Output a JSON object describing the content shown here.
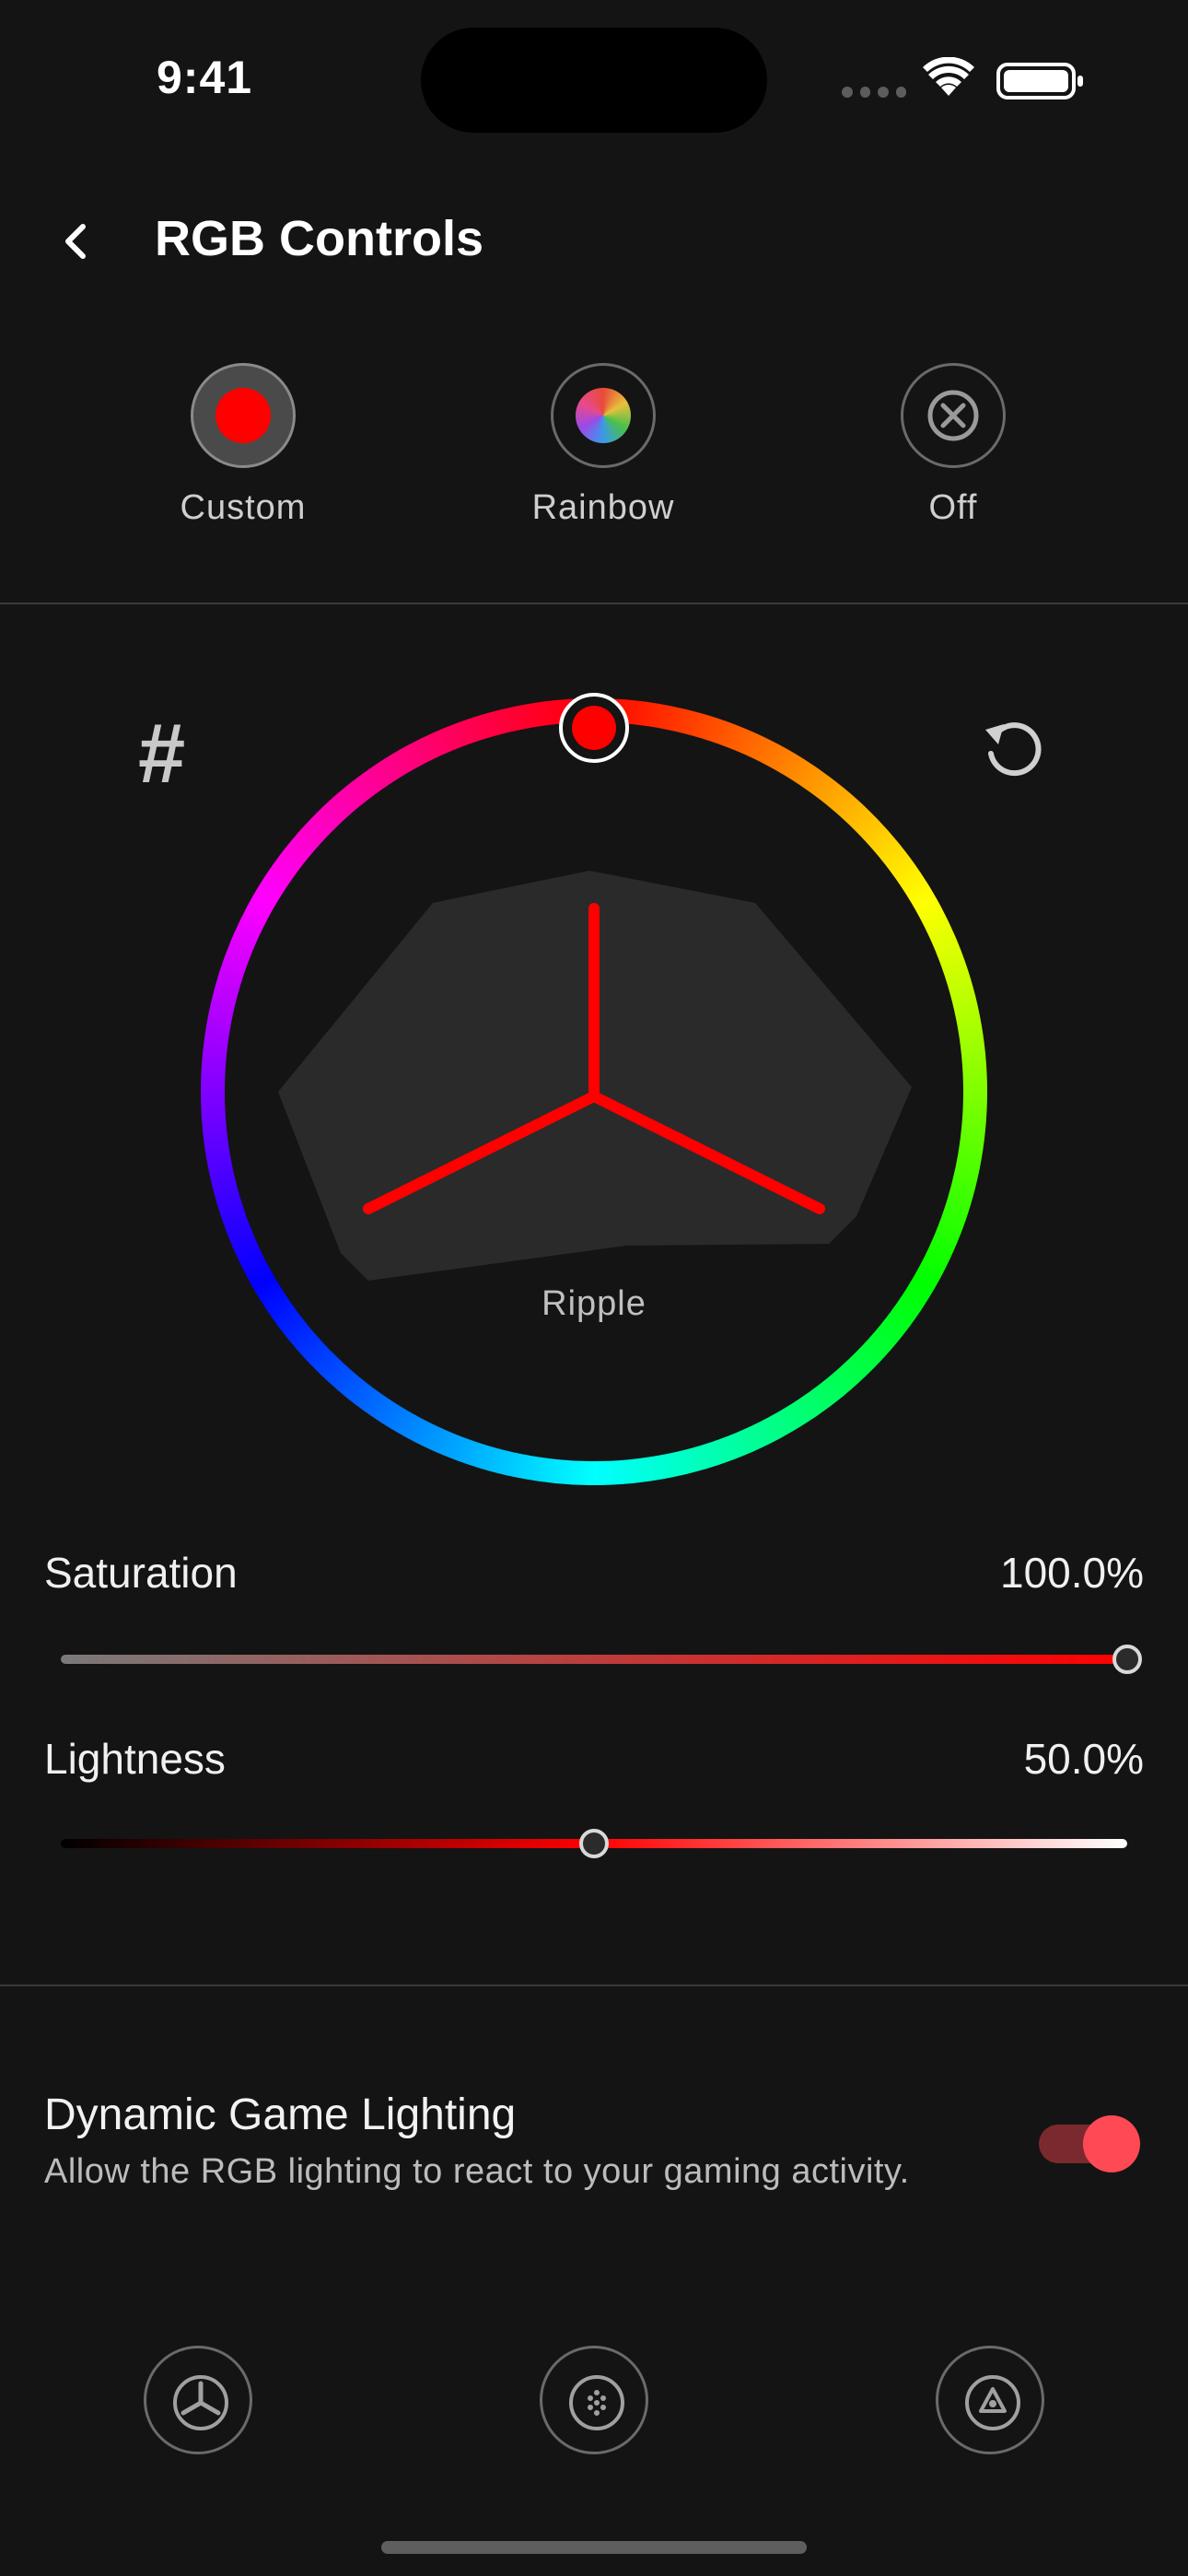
{
  "status_bar": {
    "time": "9:41"
  },
  "header": {
    "title": "RGB Controls"
  },
  "modes": [
    {
      "label": "Custom",
      "icon": "red-dot-icon",
      "selected": true
    },
    {
      "label": "Rainbow",
      "icon": "rainbow-dot-icon",
      "selected": false
    },
    {
      "label": "Off",
      "icon": "off-x-icon",
      "selected": false
    }
  ],
  "color_wheel": {
    "hex_symbol": "#",
    "selected_color": "#ff0000",
    "hue_degrees": 0,
    "effect_label": "Ripple",
    "reset_icon": "reset-icon"
  },
  "saturation": {
    "label": "Saturation",
    "value_text": "100.0%",
    "value": 1.0
  },
  "lightness": {
    "label": "Lightness",
    "value_text": "50.0%",
    "value": 0.5
  },
  "dynamic_lighting": {
    "title": "Dynamic Game Lighting",
    "description": "Allow the RGB lighting to react to your gaming activity.",
    "enabled": true
  },
  "bottom_nav": [
    {
      "icon": "trilogo-icon",
      "label": ""
    },
    {
      "icon": "dots-grid-icon",
      "label": ""
    },
    {
      "icon": "device-logo-icon",
      "label": ""
    }
  ],
  "colors": {
    "background": "#141414",
    "accent": "#ff0000",
    "toggle_on": "#ff4a55"
  }
}
